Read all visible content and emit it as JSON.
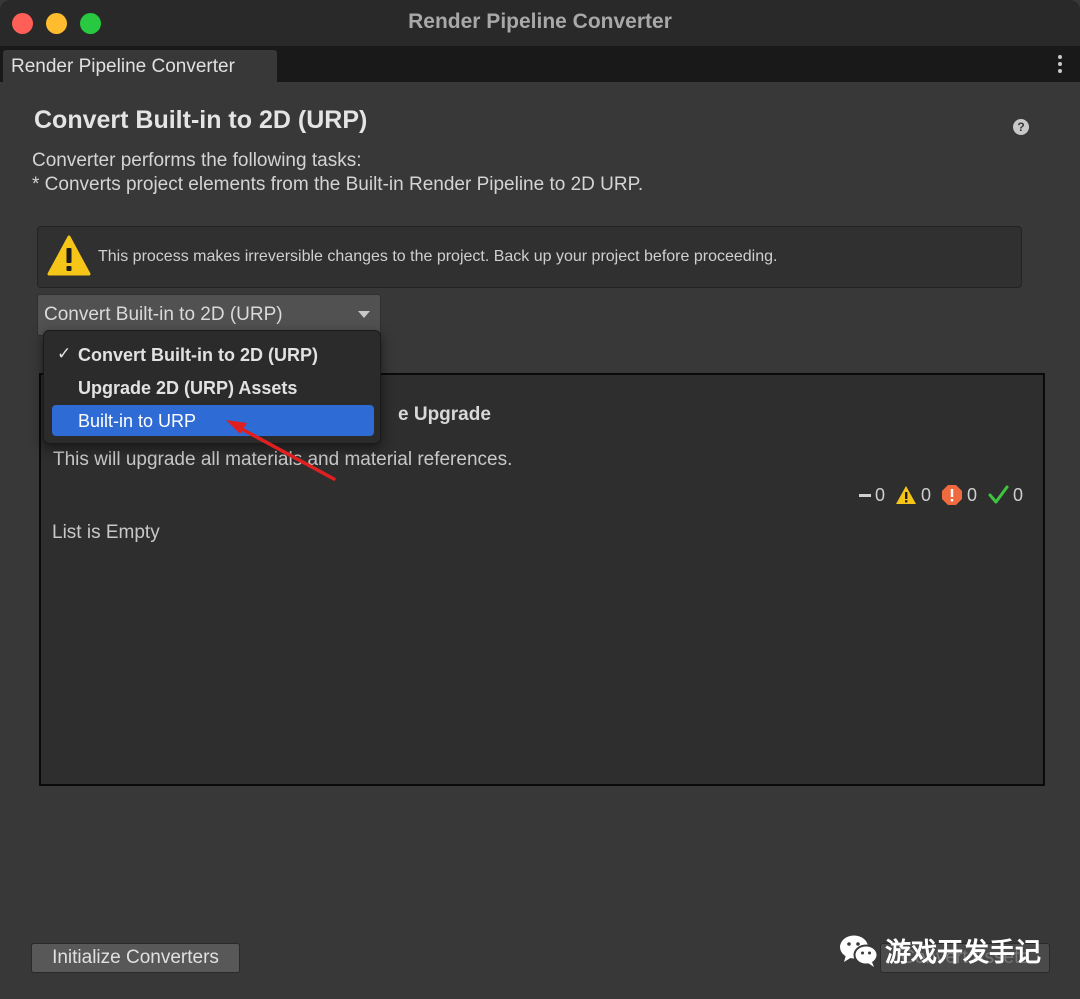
{
  "window": {
    "title": "Render Pipeline Converter"
  },
  "tab": {
    "label": "Render Pipeline Converter"
  },
  "heading": "Convert Built-in to 2D (URP)",
  "help_icon": "?",
  "description": {
    "line1": "Converter performs the following tasks:",
    "line2": "* Converts project elements from the Built-in Render Pipeline to 2D URP."
  },
  "warning": {
    "text": "This process makes irreversible changes to the project. Back up your project before proceeding."
  },
  "dropdown": {
    "selected": "Convert Built-in to 2D (URP)",
    "options": [
      {
        "label": "Convert Built-in to 2D (URP)",
        "checked": true
      },
      {
        "label": "Upgrade 2D (URP) Assets",
        "checked": false
      },
      {
        "label": "Built-in to URP",
        "checked": false,
        "highlighted": true
      }
    ],
    "check_glyph": "✓"
  },
  "panel": {
    "title_visible": "e Upgrade",
    "description": "This will upgrade all materials and material references.",
    "counts": {
      "pending": "0",
      "warnings": "0",
      "errors": "0",
      "success": "0"
    },
    "empty": "List is Empty"
  },
  "buttons": {
    "initialize": "Initialize Converters",
    "convert": "Convert Assets"
  },
  "watermark": {
    "text": "游戏开发手记"
  },
  "colors": {
    "highlight": "#2f6bd4",
    "warning": "#f5c518",
    "error": "#f06a3f",
    "success": "#3ec43e",
    "arrow": "#e02020"
  }
}
